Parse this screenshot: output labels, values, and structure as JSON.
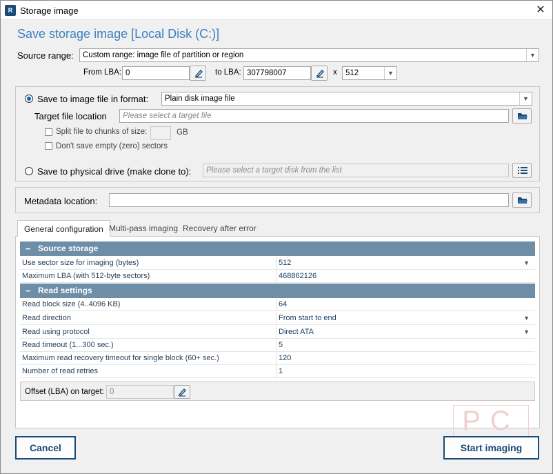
{
  "window": {
    "title": "Storage image",
    "heading": "Save storage image [Local Disk (C:)]"
  },
  "source": {
    "range_label": "Source range:",
    "range_value": "Custom range: image file of partition or region",
    "from_label": "From LBA:",
    "from_value": "0",
    "to_label": "to LBA:",
    "to_value": "307798007",
    "x_label": "x",
    "sector_value": "512"
  },
  "save_image": {
    "label": "Save to image file in format:",
    "format_value": "Plain disk image file",
    "target_label": "Target file location",
    "target_placeholder": "Please select a target file",
    "split_label": "Split file to chunks of size:",
    "split_unit": "GB",
    "empty_label": "Don't save empty (zero) sectors"
  },
  "clone": {
    "label": "Save to physical drive (make clone to):",
    "placeholder": "Please select a target disk from the list"
  },
  "metadata": {
    "label": "Metadata location:",
    "value": ""
  },
  "tabs": [
    {
      "label": "General configuration"
    },
    {
      "label": "Multi-pass imaging"
    },
    {
      "label": "Recovery after error"
    }
  ],
  "grid": {
    "source_header": "Source storage",
    "source_rows": [
      {
        "key": "Use sector size for imaging (bytes)",
        "value": "512"
      },
      {
        "key": "Maximum LBA (with 512-byte sectors)",
        "value": "468862126"
      }
    ],
    "read_header": "Read settings",
    "read_rows": [
      {
        "key": "Read block size (4..4096 KB)",
        "value": "64"
      },
      {
        "key": "Read direction",
        "value": "From start to end"
      },
      {
        "key": "Read using protocol",
        "value": "Direct ATA"
      },
      {
        "key": "Read timeout (1...300 sec.)",
        "value": "5"
      },
      {
        "key": "Maximum read recovery timeout for single block (60+ sec.)",
        "value": "120"
      },
      {
        "key": "Number of read retries",
        "value": "1"
      }
    ]
  },
  "offset": {
    "label": "Offset (LBA) on target:",
    "value": "0"
  },
  "buttons": {
    "cancel": "Cancel",
    "start": "Start imaging"
  },
  "icons": {
    "app": "app-icon",
    "close": "close-icon",
    "edit": "pencil-icon",
    "folder": "folder-open-icon",
    "list": "list-icon"
  }
}
